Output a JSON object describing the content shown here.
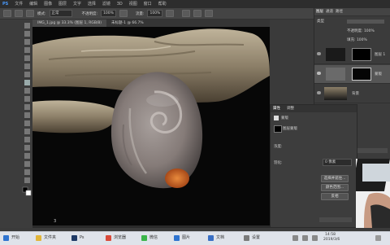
{
  "colors": {
    "accent": "#2f74d0",
    "canvas_bg": "#070707",
    "panel_bg": "#3b3b3b"
  },
  "menubar": {
    "items": [
      "PS",
      "文件",
      "编辑",
      "图像",
      "图层",
      "文字",
      "选择",
      "滤镜",
      "3D",
      "视图",
      "窗口",
      "帮助"
    ]
  },
  "optbar": {
    "mode": "模式:",
    "mode_value": "正常",
    "opacity_label": "不透明度:",
    "opacity_value": "100%",
    "flow_label": "流量:",
    "flow_value": "100%"
  },
  "tabs": [
    {
      "label": "IMG_1.jpg @ 33.3% (图层 1, RGB/8)"
    },
    {
      "label": "未标题-1 @ 66.7%"
    }
  ],
  "canvas": {
    "footer_num": "3"
  },
  "layers": {
    "tabs": [
      "图层",
      "通道",
      "路径"
    ],
    "kind": "类型",
    "opacity": "不透明度: 100%",
    "fill": "填充: 100%",
    "rows": [
      {
        "name": "图层 1"
      },
      {
        "name": "蒙版"
      },
      {
        "name": "背景"
      }
    ]
  },
  "properties": {
    "title": "属性",
    "adjust": "调整",
    "items": [
      "蒙版",
      "图层蒙版"
    ],
    "density_label": "浓度:",
    "feather_label": "羽化:",
    "value": "0 像素",
    "buttons": [
      "选择并遮住...",
      "颜色范围...",
      "反相"
    ]
  },
  "taskbar": {
    "items": [
      "开始",
      "文件夹",
      "Ps",
      "浏览器",
      "微信",
      "图片",
      "文档",
      "设置"
    ],
    "time": "14:58",
    "date": "2019/3/6"
  }
}
